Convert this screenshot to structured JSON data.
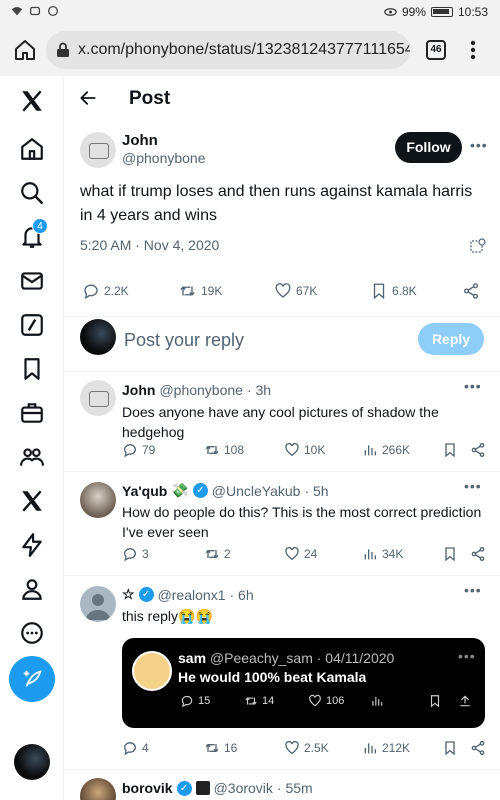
{
  "status_bar": {
    "battery": "99%",
    "time": "10:53"
  },
  "browser": {
    "url": "x.com/phonybone/status/1323812437771116544",
    "tab_count": "46"
  },
  "nav": {
    "notification_count": "4"
  },
  "header": {
    "title": "Post"
  },
  "main_post": {
    "author_name": "John",
    "author_handle": "@phonybone",
    "follow_label": "Follow",
    "text": "what if trump loses and then runs against kamala harris in 4 years and wins",
    "timestamp": "5:20 AM · Nov 4, 2020",
    "replies": "2.2K",
    "reposts": "19K",
    "likes": "67K",
    "bookmarks": "6.8K"
  },
  "reply_box": {
    "placeholder": "Post your reply",
    "button_label": "Reply"
  },
  "replies": [
    {
      "name": "John",
      "handle": "@phonybone",
      "time": "· 3h",
      "text": "Does anyone have any cool pictures of shadow the hedgehog",
      "replies": "79",
      "reposts": "108",
      "likes": "10K",
      "views": "266K"
    },
    {
      "name": "Ya'qub",
      "badge_emoji": "💸",
      "handle": "@UncleYakub",
      "time": "· 5h",
      "text": "How do people do this? This is the most correct prediction I've ever seen",
      "replies": "3",
      "reposts": "2",
      "likes": "24",
      "views": "34K"
    },
    {
      "name": "☆",
      "handle": "@realonx1",
      "time": "· 6h",
      "text": "this reply😭😭",
      "replies": "4",
      "reposts": "16",
      "likes": "2.5K",
      "views": "212K",
      "quote": {
        "author": "sam",
        "handle": "@Peeachy_sam · 04/11/2020",
        "text": "He would 100% beat Kamala",
        "replies": "15",
        "reposts": "14",
        "likes": "106"
      }
    },
    {
      "name": "borovik",
      "handle": "@3orovik",
      "time": "· 55m"
    }
  ],
  "colors": {
    "accent": "#1d9bf0",
    "text": "#0f1419",
    "muted": "#536471"
  }
}
